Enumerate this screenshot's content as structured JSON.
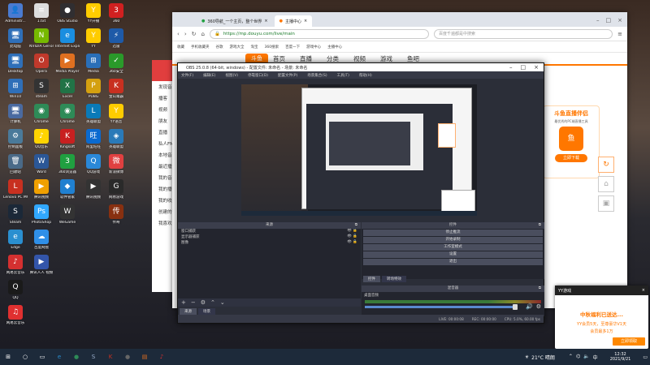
{
  "desktop": {
    "icons": [
      {
        "label": "Administr...",
        "color": "#4a7bd0",
        "glyph": "👤"
      },
      {
        "label": "此电脑",
        "color": "#2f6fb8",
        "glyph": "🖥"
      },
      {
        "label": "Desktop",
        "color": "#2f6fb8",
        "glyph": "🖥"
      },
      {
        "label": "Win10",
        "color": "#2f6fb8",
        "glyph": "⊞"
      },
      {
        "label": "计算机",
        "color": "#4a6aa0",
        "glyph": "🖥"
      },
      {
        "label": "控制面板",
        "color": "#4a7a9a",
        "glyph": "⚙"
      },
      {
        "label": "回收站",
        "color": "#4a6a88",
        "glyph": "🗑"
      },
      {
        "label": "Lenovo PC MGR",
        "color": "#c83020",
        "glyph": "L"
      },
      {
        "label": "Steam",
        "color": "#1b2838",
        "glyph": "S"
      },
      {
        "label": "Edge",
        "color": "#2a8fd0",
        "glyph": "e"
      },
      {
        "label": "网易云音乐",
        "color": "#d43030",
        "glyph": "♪"
      },
      {
        "label": "QQ",
        "color": "#1a1a1a",
        "glyph": "Q"
      },
      {
        "label": "网易云音乐",
        "color": "#e03030",
        "glyph": "♫"
      }
    ],
    "icons2": [
      {
        "label": "1.txt",
        "color": "#dddddd",
        "glyph": "≡"
      },
      {
        "label": "NVIDIA GeForce",
        "color": "#76b900",
        "glyph": "N"
      },
      {
        "label": "Opera",
        "color": "#c0392b",
        "glyph": "O"
      },
      {
        "label": "steam",
        "color": "#333",
        "glyph": "S"
      },
      {
        "label": "Chrome",
        "color": "#2e8b57",
        "glyph": "◉"
      },
      {
        "label": "QQ音乐",
        "color": "#ffd400",
        "glyph": "♪"
      },
      {
        "label": "Word",
        "color": "#2b5797",
        "glyph": "W"
      },
      {
        "label": "腾讯视频",
        "color": "#f0a000",
        "glyph": "▶"
      },
      {
        "label": "PhotoShop",
        "color": "#31a8ff",
        "glyph": "Ps"
      },
      {
        "label": "百度网盘",
        "color": "#2f8fe8",
        "glyph": "☁"
      },
      {
        "label": "腾讯人人 视频",
        "color": "#3355aa",
        "glyph": "▶"
      }
    ],
    "icons3": [
      {
        "label": "OBS Studio",
        "color": "#302e31",
        "glyph": "●"
      },
      {
        "label": "Internet Explorer",
        "color": "#1a8ee0",
        "glyph": "e"
      },
      {
        "label": "Media Player",
        "color": "#e07020",
        "glyph": "▶"
      },
      {
        "label": "Excel",
        "color": "#217346",
        "glyph": "X"
      },
      {
        "label": "Chrome",
        "color": "#2e8b57",
        "glyph": "◉"
      },
      {
        "label": "Kingsoft",
        "color": "#c82020",
        "glyph": "K"
      },
      {
        "label": "360浏览器",
        "color": "#20a040",
        "glyph": "3"
      },
      {
        "label": "软件管家",
        "color": "#2080d0",
        "glyph": "◆"
      },
      {
        "label": "WeGame",
        "color": "#333",
        "glyph": "W"
      }
    ],
    "icons4": [
      {
        "label": "YY开播",
        "color": "#ffcc00",
        "glyph": "Y"
      },
      {
        "label": "YY",
        "color": "#ffcc00",
        "glyph": "Y"
      },
      {
        "label": "Media",
        "color": "#2a6fb8",
        "glyph": "⊞"
      },
      {
        "label": "PUBG",
        "color": "#d4a010",
        "glyph": "P"
      },
      {
        "label": "英雄联盟",
        "color": "#0a7ab8",
        "glyph": "L"
      },
      {
        "label": "阿里旺旺",
        "color": "#0a6ad0",
        "glyph": "旺"
      },
      {
        "label": "QQ游戏",
        "color": "#2a88d8",
        "glyph": "Q"
      },
      {
        "label": "腾讯视频",
        "color": "#333",
        "glyph": "▶"
      }
    ],
    "icons5": [
      {
        "label": "360",
        "color": "#d02020",
        "glyph": "3"
      },
      {
        "label": "迅雷",
        "color": "#1e5aa8",
        "glyph": "⚡"
      },
      {
        "label": "360安全",
        "color": "#2a9a2a",
        "glyph": "✓"
      },
      {
        "label": "金山毒霸",
        "color": "#c83020",
        "glyph": "K"
      },
      {
        "label": "YY语音",
        "color": "#ffcc00",
        "glyph": "Y"
      },
      {
        "label": "英雄联盟",
        "color": "#2a7ab8",
        "glyph": "◈"
      },
      {
        "label": "新浪微博",
        "color": "#e04040",
        "glyph": "微"
      },
      {
        "label": "网易游戏",
        "color": "#2a2a2a",
        "glyph": "G"
      },
      {
        "label": "传奇",
        "color": "#883010",
        "glyph": "传"
      }
    ]
  },
  "browser": {
    "tabs": [
      {
        "label": "360导航_一个主页，整个世界",
        "active": false
      },
      {
        "label": "主播中心",
        "active": true
      }
    ],
    "url": "https://mp.douyu.com/live/main",
    "search_placeholder": "百度千遍都是中搜索",
    "bookmarks": [
      "收藏",
      "手机收藏夹",
      "谷歌",
      "游戏大全",
      "淘宝",
      "360搜索",
      "百度一下",
      "游戏中心",
      "主播中心"
    ],
    "douyu_nav": [
      "首页",
      "直播",
      "分类",
      "视频",
      "游戏",
      "鱼吧"
    ],
    "side_title": "斗鱼直播伴侣",
    "side_sub": "最优秀的PC端直播工具",
    "side_btn": "立即下载"
  },
  "netease": {
    "items": [
      "发现音乐",
      "播客",
      "视频",
      "朋友",
      "直播",
      "私人FM",
      "本地音乐",
      "最近播放",
      "我的音乐云盘",
      "我的播客",
      "我的收藏",
      "创建的歌单",
      "我喜欢的音乐"
    ]
  },
  "obs": {
    "title": "OBS 25.0.8 (64-bit, windows) - 配置文件: 未命名 - 场景: 未命名",
    "menu": [
      "文件(F)",
      "编辑(E)",
      "视图(V)",
      "停靠窗口(D)",
      "配置文件(P)",
      "场景集合(S)",
      "工具(T)",
      "帮助(H)"
    ],
    "scenes_header": "来源",
    "sources": [
      "窗口捕获",
      "显示器捕获",
      "图像"
    ],
    "controls_header": "控件",
    "controls": [
      "停止推流",
      "开始录制",
      "工作室模式",
      "设置",
      "退出"
    ],
    "tabs": [
      "控件",
      "转场特效"
    ],
    "mixer_header": "混音器",
    "mixer_label": "桌面音频",
    "scene_tabs": [
      "来源",
      "场景"
    ],
    "status": [
      "LIVE: 00:00:08",
      "REC: 00:00:00",
      "CPU: 5.0%, 60.00 fps"
    ]
  },
  "yy_popup": {
    "header": "YY游戏",
    "title": "中秋福利已送达...",
    "line1": "YY会员5天，至尊豪华V1天",
    "line2": "会员最多1万",
    "button": "立即领取"
  },
  "taskbar": {
    "weather": "21°C 晴朗",
    "time": "12:32",
    "date": "2021/9/21",
    "apps": [
      {
        "glyph": "⊞",
        "color": "#ffffff",
        "name": "start"
      },
      {
        "glyph": "○",
        "color": "#ffffff",
        "name": "search"
      },
      {
        "glyph": "▭",
        "color": "#ffffff",
        "name": "taskview"
      },
      {
        "glyph": "e",
        "color": "#2a8fd0",
        "name": "edge"
      },
      {
        "glyph": "●",
        "color": "#2e8b57",
        "name": "chrome"
      },
      {
        "glyph": "S",
        "color": "#9aaecb",
        "name": "steam"
      },
      {
        "glyph": "K",
        "color": "#c83020",
        "name": "kingsoft"
      },
      {
        "glyph": "●",
        "color": "#666",
        "name": "obs"
      },
      {
        "glyph": "▤",
        "color": "#e07020",
        "name": "douyu"
      },
      {
        "glyph": "♪",
        "color": "#e03030",
        "name": "netease"
      }
    ]
  }
}
